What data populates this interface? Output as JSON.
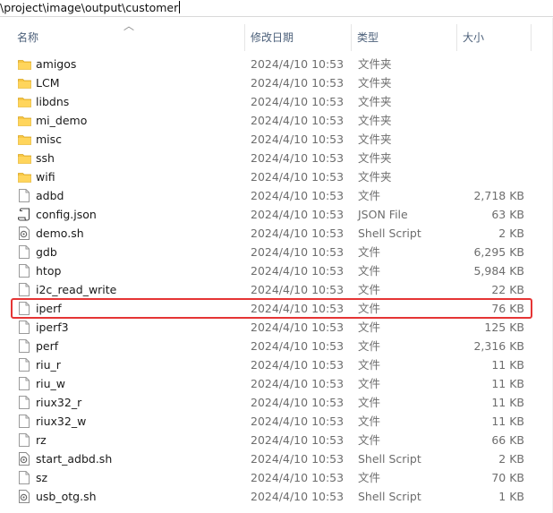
{
  "address_bar": {
    "path": "\\project\\image\\output\\customer"
  },
  "columns": {
    "name": "名称",
    "date": "修改日期",
    "type": "类型",
    "size": "大小"
  },
  "files": [
    {
      "name": "amigos",
      "date": "2024/4/10 10:53",
      "type": "文件夹",
      "size": "",
      "icon": "folder-icon"
    },
    {
      "name": "LCM",
      "date": "2024/4/10 10:53",
      "type": "文件夹",
      "size": "",
      "icon": "folder-icon"
    },
    {
      "name": "libdns",
      "date": "2024/4/10 10:53",
      "type": "文件夹",
      "size": "",
      "icon": "folder-icon"
    },
    {
      "name": "mi_demo",
      "date": "2024/4/10 10:53",
      "type": "文件夹",
      "size": "",
      "icon": "folder-icon"
    },
    {
      "name": "misc",
      "date": "2024/4/10 10:53",
      "type": "文件夹",
      "size": "",
      "icon": "folder-icon"
    },
    {
      "name": "ssh",
      "date": "2024/4/10 10:53",
      "type": "文件夹",
      "size": "",
      "icon": "folder-icon"
    },
    {
      "name": "wifi",
      "date": "2024/4/10 10:53",
      "type": "文件夹",
      "size": "",
      "icon": "folder-icon"
    },
    {
      "name": "adbd",
      "date": "2024/4/10 10:53",
      "type": "文件",
      "size": "2,718 KB",
      "icon": "file-icon"
    },
    {
      "name": "config.json",
      "date": "2024/4/10 10:53",
      "type": "JSON File",
      "size": "63 KB",
      "icon": "json-file-icon"
    },
    {
      "name": "demo.sh",
      "date": "2024/4/10 10:53",
      "type": "Shell Script",
      "size": "2 KB",
      "icon": "shell-script-icon"
    },
    {
      "name": "gdb",
      "date": "2024/4/10 10:53",
      "type": "文件",
      "size": "6,295 KB",
      "icon": "file-icon"
    },
    {
      "name": "htop",
      "date": "2024/4/10 10:53",
      "type": "文件",
      "size": "5,984 KB",
      "icon": "file-icon"
    },
    {
      "name": "i2c_read_write",
      "date": "2024/4/10 10:53",
      "type": "文件",
      "size": "22 KB",
      "icon": "file-icon"
    },
    {
      "name": "iperf",
      "date": "2024/4/10 10:53",
      "type": "文件",
      "size": "76 KB",
      "icon": "file-icon"
    },
    {
      "name": "iperf3",
      "date": "2024/4/10 10:53",
      "type": "文件",
      "size": "125 KB",
      "icon": "file-icon"
    },
    {
      "name": "perf",
      "date": "2024/4/10 10:53",
      "type": "文件",
      "size": "2,316 KB",
      "icon": "file-icon"
    },
    {
      "name": "riu_r",
      "date": "2024/4/10 10:53",
      "type": "文件",
      "size": "11 KB",
      "icon": "file-icon"
    },
    {
      "name": "riu_w",
      "date": "2024/4/10 10:53",
      "type": "文件",
      "size": "11 KB",
      "icon": "file-icon"
    },
    {
      "name": "riux32_r",
      "date": "2024/4/10 10:53",
      "type": "文件",
      "size": "11 KB",
      "icon": "file-icon"
    },
    {
      "name": "riux32_w",
      "date": "2024/4/10 10:53",
      "type": "文件",
      "size": "11 KB",
      "icon": "file-icon"
    },
    {
      "name": "rz",
      "date": "2024/4/10 10:53",
      "type": "文件",
      "size": "66 KB",
      "icon": "file-icon"
    },
    {
      "name": "start_adbd.sh",
      "date": "2024/4/10 10:53",
      "type": "Shell Script",
      "size": "2 KB",
      "icon": "shell-script-icon"
    },
    {
      "name": "sz",
      "date": "2024/4/10 10:53",
      "type": "文件",
      "size": "70 KB",
      "icon": "file-icon"
    },
    {
      "name": "usb_otg.sh",
      "date": "2024/4/10 10:53",
      "type": "Shell Script",
      "size": "1 KB",
      "icon": "shell-script-icon"
    }
  ],
  "highlighted_file": "iperf",
  "colors": {
    "highlight": "#e53535",
    "folder": "#f8c744",
    "header_text": "#4c607a"
  }
}
